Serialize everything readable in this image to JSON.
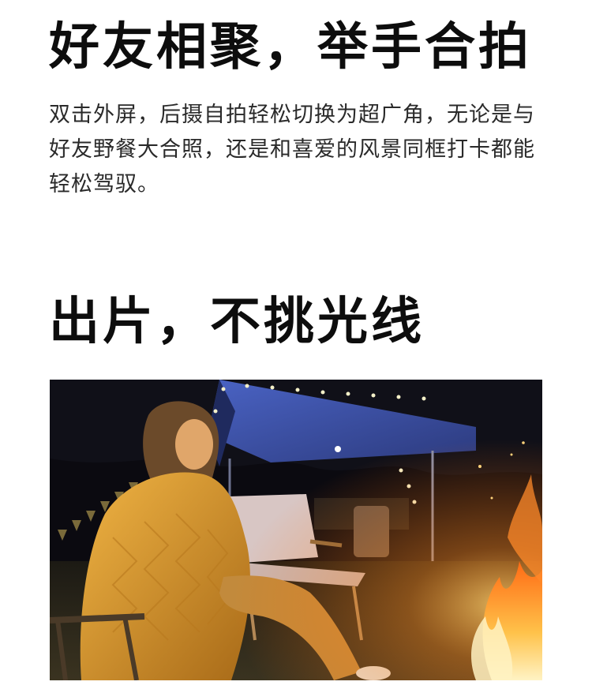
{
  "sections": [
    {
      "title": "好友相聚，举手合拍",
      "body": "双击外屏，后摄自拍轻松切换为超广角，无论是与好友野餐大合照，还是和喜爱的风景同框打卡都能轻松驾驭。"
    },
    {
      "title": "出片，不挑光线"
    }
  ],
  "photo": {
    "colors": {
      "night_sky": "#0b0a10",
      "tent": "#3b4fa0",
      "fire": "#ffb347",
      "blanket": "#d99a2c",
      "grass": "#2c2a1a"
    }
  }
}
